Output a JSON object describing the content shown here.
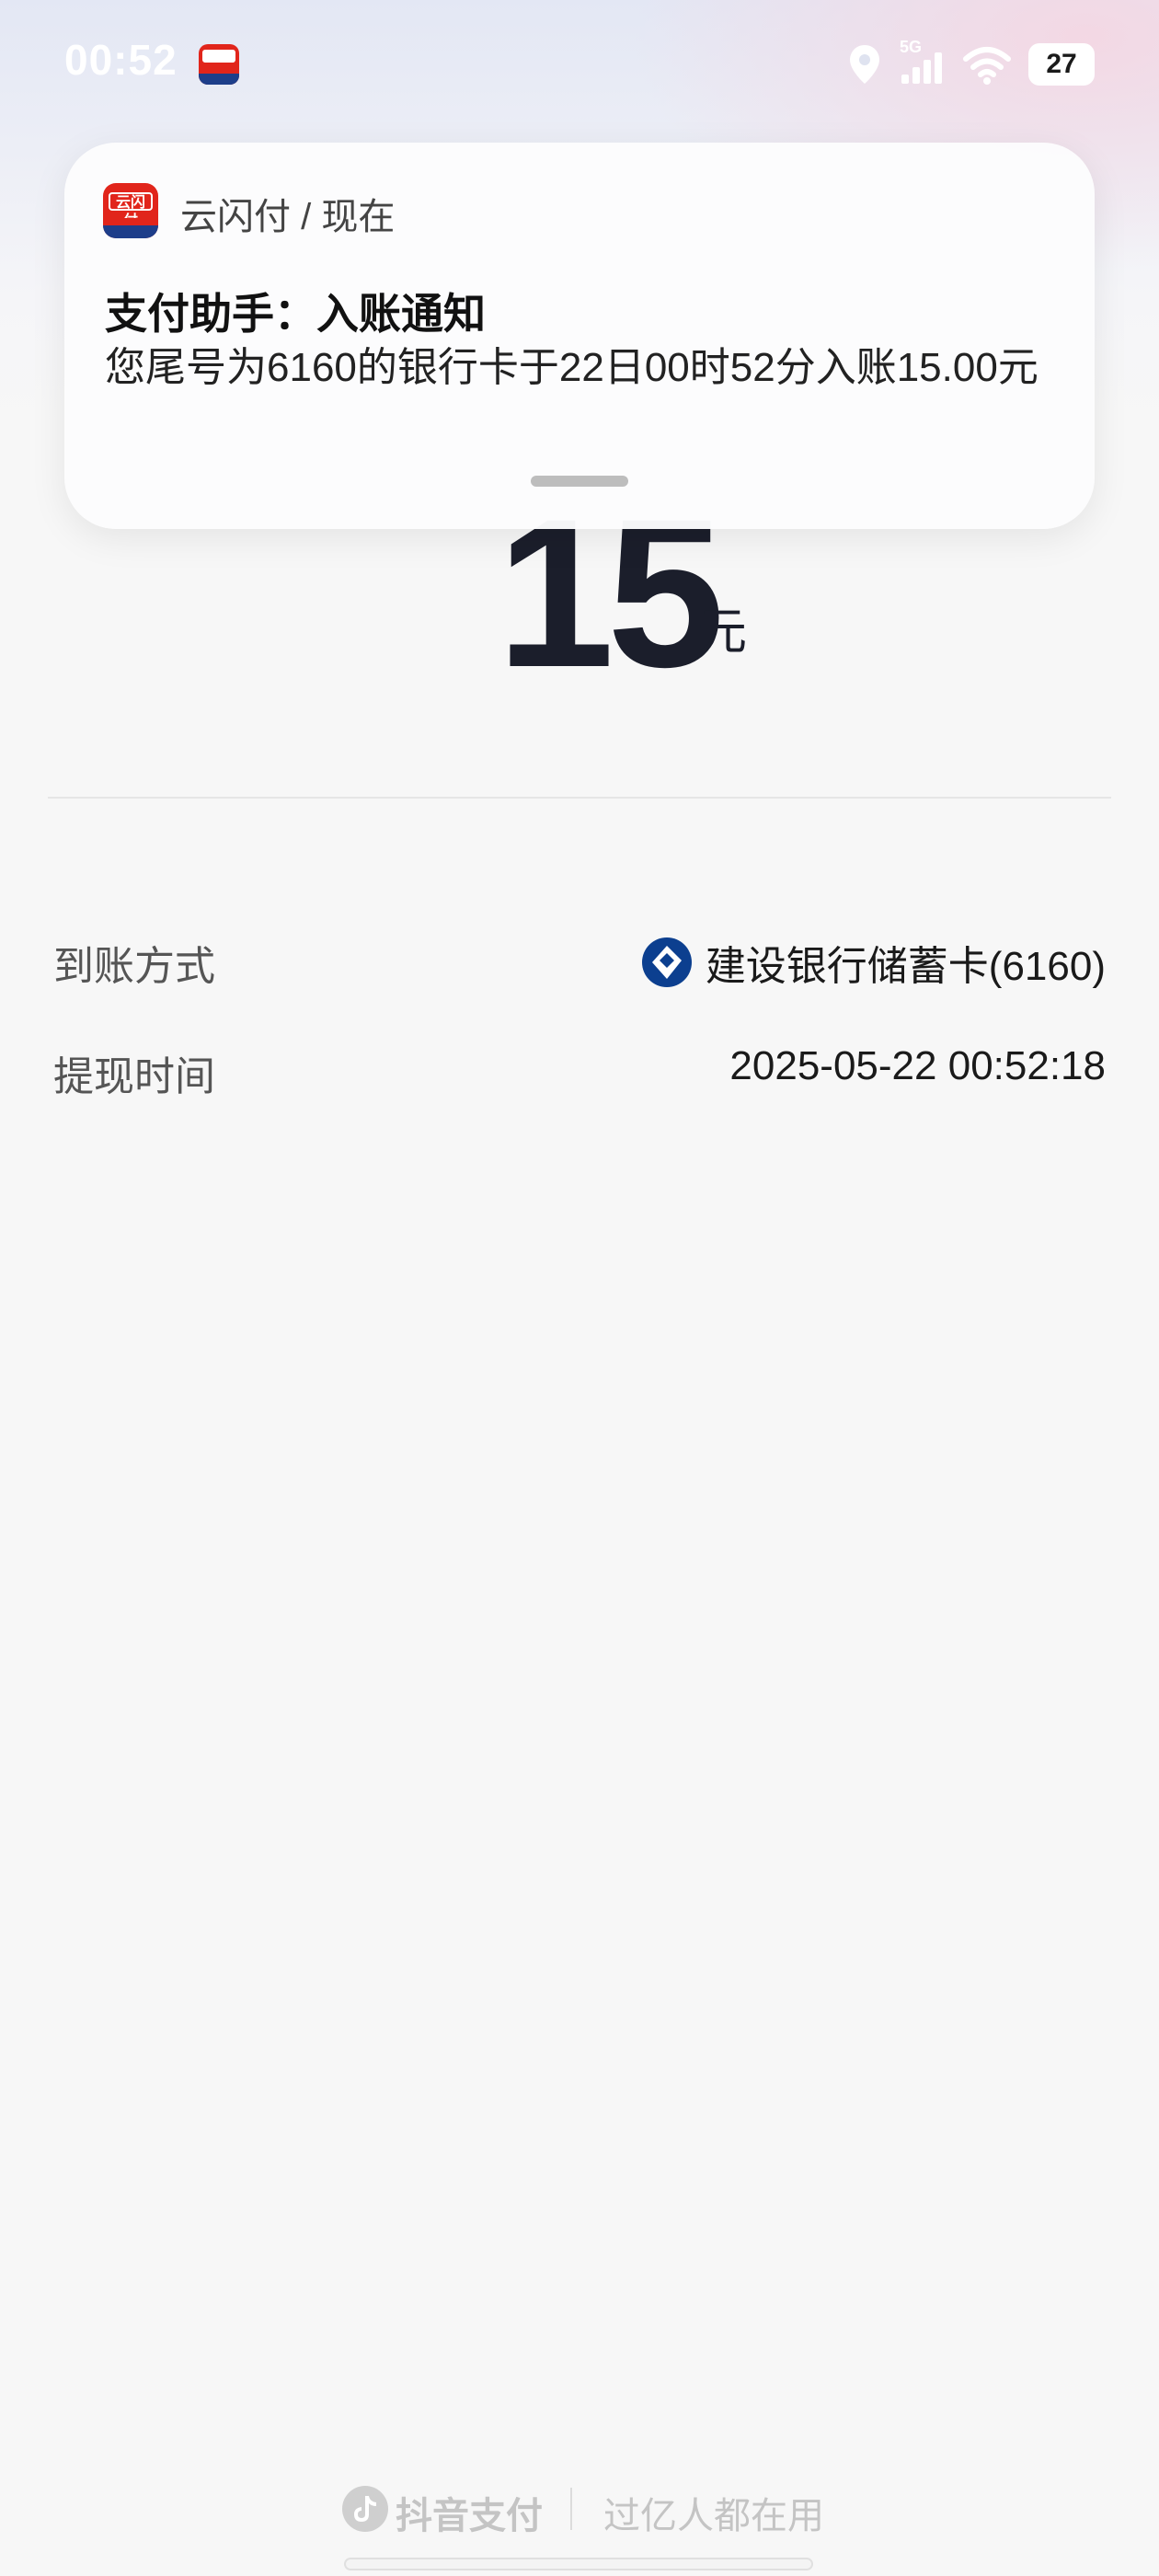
{
  "status_bar": {
    "time": "00:52",
    "network": "5G",
    "battery": "27"
  },
  "notification": {
    "app_name_source": "云闪付 / 现在",
    "title": "支付助手：入账通知",
    "body": "您尾号为6160的银行卡于22日00时52分入账15.00元"
  },
  "amount": {
    "value": "15",
    "unit": "元"
  },
  "details": {
    "method_label": "到账方式",
    "method_value": "建设银行储蓄卡(6160)",
    "time_label": "提现时间",
    "time_value": "2025-05-22 00:52:18"
  },
  "footer": {
    "brand": "抖音支付",
    "slogan": "过亿人都在用"
  },
  "colors": {
    "bank_blue": "#0c3f8f",
    "unionpay_red": "#e1251b"
  },
  "icons": [
    "unionpay-app-icon",
    "location-icon",
    "signal-icon",
    "wifi-icon",
    "ccb-bank-icon",
    "douyin-icon"
  ]
}
